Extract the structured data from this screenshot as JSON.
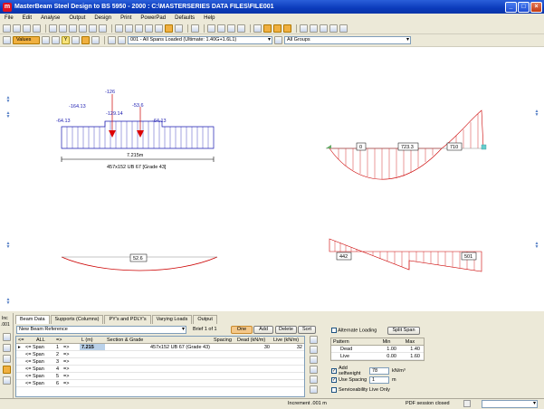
{
  "window": {
    "title": "MasterBeam Steel Design to BS 5950 - 2000 : C:\\MASTERSERIES DATA FILES\\FILE001",
    "app_icon_letter": "m"
  },
  "menu": [
    "File",
    "Edit",
    "Analyse",
    "Output",
    "Design",
    "Print",
    "PowerPad",
    "Defaults",
    "Help"
  ],
  "toolbar2": {
    "values_label": "Values",
    "loadcase": "001 - All Spans Loaded  (Ultimate: 1.40G+1.6L1)",
    "groups": "All Groups"
  },
  "loading_diagram": {
    "labels": [
      "-126",
      "-164.13",
      "-53.6",
      "-64.13",
      "-129.14",
      "-64.13"
    ],
    "span_length": "7.215m",
    "section": "457x152 UB 67 [Grade 43]"
  },
  "moment_diagram": {
    "labels": [
      "0",
      "723.3",
      "710"
    ]
  },
  "deflection_diagram": {
    "label": "52.6"
  },
  "shear_diagram": {
    "labels": [
      "442",
      "501"
    ]
  },
  "side_labels": {
    "inc": "Inc",
    ".001": ".001"
  },
  "tabs": [
    "Beam Data",
    "Supports (Columns)",
    "PY's and PDLY's",
    "Varying Loads",
    "Output"
  ],
  "beam_ref": {
    "placeholder": "New Beam Reference",
    "brief": "Brief 1 of 1"
  },
  "actions": {
    "one": "One",
    "add": "Add",
    "delete": "Delete",
    "sort": "Sort"
  },
  "grid": {
    "headers": [
      "<=",
      "ALL",
      "=>",
      "L (m)",
      "Section & Grade",
      "Spacing",
      "Dead (kN/m)",
      "Live (kN/m)"
    ],
    "rows": [
      {
        "a": "<= Span",
        "n": "1",
        "b": "=>",
        "l": "7.215",
        "sec": "457x152 UB 67 (Grade 43)",
        "dead": "30",
        "live": "32"
      },
      {
        "a": "<= Span",
        "n": "2",
        "b": "=>",
        "l": "",
        "sec": "",
        "dead": "",
        "live": ""
      },
      {
        "a": "<= Span",
        "n": "3",
        "b": "=>",
        "l": "",
        "sec": "",
        "dead": "",
        "live": ""
      },
      {
        "a": "<= Span",
        "n": "4",
        "b": "=>",
        "l": "",
        "sec": "",
        "dead": "",
        "live": ""
      },
      {
        "a": "<= Span",
        "n": "5",
        "b": "=>",
        "l": "",
        "sec": "",
        "dead": "",
        "live": ""
      },
      {
        "a": "<= Span",
        "n": "6",
        "b": "=>",
        "l": "",
        "sec": "",
        "dead": "",
        "live": ""
      }
    ]
  },
  "options": {
    "alternate_loading": "Alternate Loading",
    "split_span": "Split Span",
    "pattern_headers": [
      "Pattern",
      "Min",
      "Max"
    ],
    "pattern_rows": [
      {
        "name": "Dead",
        "min": "1.00",
        "max": "1.40"
      },
      {
        "name": "Live",
        "min": "0.00",
        "max": "1.60"
      }
    ],
    "add_selfweight": "Add selfweight",
    "selfweight_value": "78",
    "selfweight_unit": "kN/m³",
    "use_spacing": "Use Spacing",
    "spacing_value": "1",
    "spacing_unit": "m",
    "serviceability": "Serviceability Live Only"
  },
  "status": {
    "increment": "Increment  .001 m",
    "pdf": "PDF session closed"
  }
}
